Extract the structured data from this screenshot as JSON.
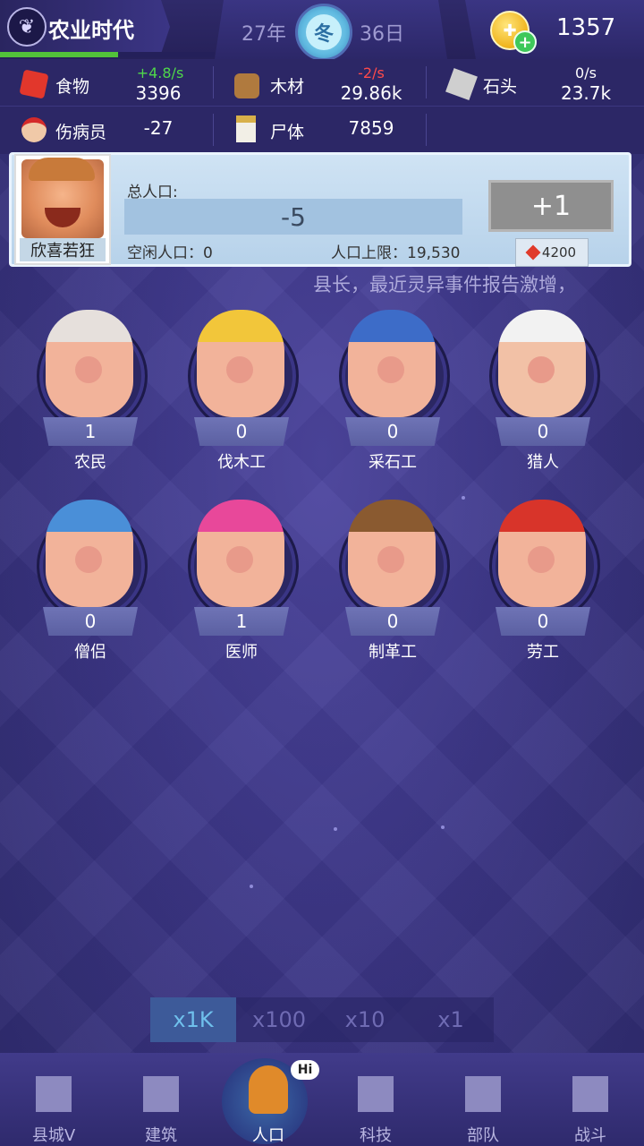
{
  "header": {
    "era": "农业时代",
    "year": "27年",
    "season": "冬",
    "day": "36日",
    "gold": "1357",
    "era_progress": 0.55
  },
  "resources": {
    "food": {
      "label": "食物",
      "rate": "+4.8/s",
      "value": "3396",
      "rate_color": "#4fd84a"
    },
    "wood": {
      "label": "木材",
      "rate": "-2/s",
      "value": "29.86k",
      "rate_color": "#ff4a4a"
    },
    "stone": {
      "label": "石头",
      "rate": "0/s",
      "value": "23.7k",
      "rate_color": "#ffffff"
    },
    "wounded": {
      "label": "伤病员",
      "value": "-27"
    },
    "corpse": {
      "label": "尸体",
      "value": "7859"
    }
  },
  "leader": {
    "name": "欣喜若狂",
    "pop_label": "总人口:",
    "pop_value": "-5",
    "idle": "空闲人口：0",
    "cap": "人口上限：19,530",
    "plus": "+1",
    "cost": "4200"
  },
  "ticker": "县长，最近灵异事件报告激增，",
  "jobs": [
    {
      "name": "农民",
      "count": "1",
      "skin": "#f2b39a",
      "hair": "#e6e0dc"
    },
    {
      "name": "伐木工",
      "count": "0",
      "skin": "#f2b39a",
      "hair": "#f2c63a"
    },
    {
      "name": "采石工",
      "count": "0",
      "skin": "#f2b39a",
      "hair": "#3d6cc8"
    },
    {
      "name": "猎人",
      "count": "0",
      "skin": "#f2c1a6",
      "hair": "#f2f2f2"
    },
    {
      "name": "僧侣",
      "count": "0",
      "skin": "#f2b39a",
      "hair": "#4a8fd8"
    },
    {
      "name": "医师",
      "count": "1",
      "skin": "#f2b39a",
      "hair": "#e8489a"
    },
    {
      "name": "制革工",
      "count": "0",
      "skin": "#f2b39a",
      "hair": "#8a5a30"
    },
    {
      "name": "劳工",
      "count": "0",
      "skin": "#f2b39a",
      "hair": "#d8342a"
    }
  ],
  "multipliers": [
    "x1K",
    "x100",
    "x10",
    "x1"
  ],
  "active_multiplier": 0,
  "nav": [
    {
      "label": "县城V",
      "icon": "castle-icon"
    },
    {
      "label": "建筑",
      "icon": "house-icon"
    },
    {
      "label": "人口",
      "icon": "person-icon",
      "badge": "Hi"
    },
    {
      "label": "科技",
      "icon": "book-icon"
    },
    {
      "label": "部队",
      "icon": "banner-icon"
    },
    {
      "label": "战斗",
      "icon": "swords-icon"
    }
  ]
}
